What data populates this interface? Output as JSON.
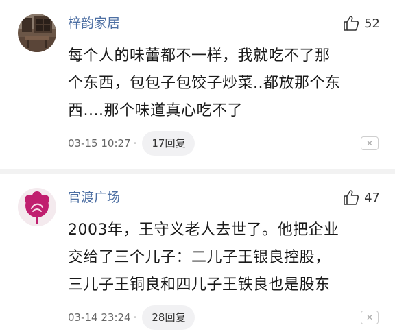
{
  "comments": [
    {
      "username": "梓韵家居",
      "likes": "52",
      "text_lines": [
        "每个人的味蕾都不一样，我就吃不了那",
        "个东西，包包子包饺子炒菜..都放那个东",
        "西....那个味道真心吃不了"
      ],
      "timestamp": "03-15 10:27",
      "separator": "·",
      "replies": "17回复",
      "avatar_icon": "room-interior-avatar"
    },
    {
      "username": "官渡广场",
      "likes": "47",
      "text_lines": [
        "2003年，王守义老人去世了。他把企业",
        "交给了三个儿子：二儿子王银良控股，",
        "三儿子王铜良和四儿子王铁良也是股东"
      ],
      "timestamp": "03-14 23:24",
      "separator": "·",
      "replies": "28回复",
      "avatar_icon": "flower-logo-avatar"
    }
  ],
  "icons": {
    "like": "thumbs-up-icon",
    "close": "close-icon"
  },
  "colors": {
    "username": "#4d6fa3",
    "text": "#1a1a1a",
    "meta": "#666666",
    "pill_bg": "#f1f1f3",
    "divider": "#f2f2f2"
  }
}
